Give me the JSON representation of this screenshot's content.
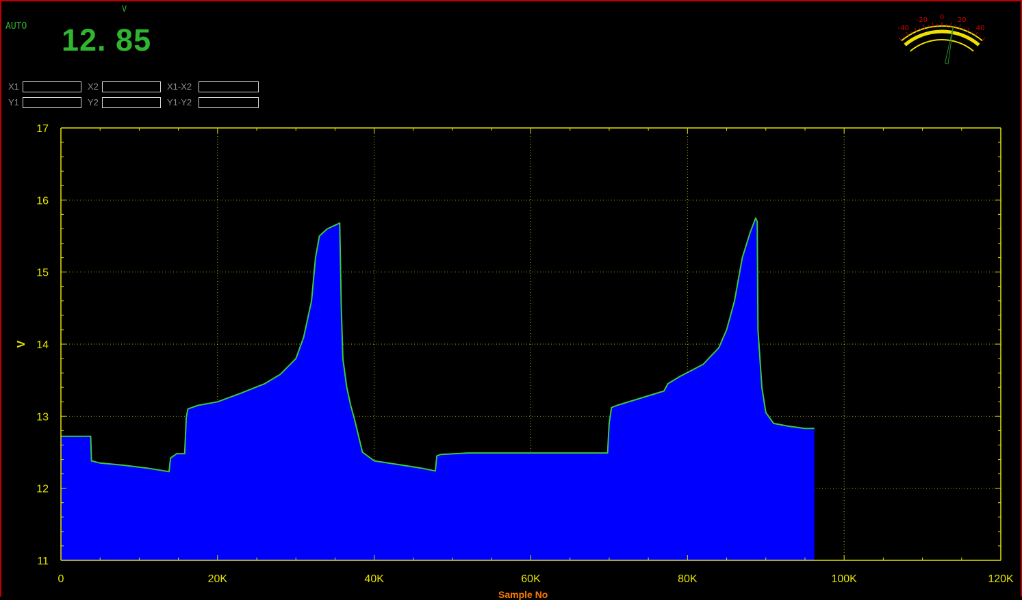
{
  "header": {
    "mode": "AUTO",
    "unit": "V",
    "reading": "12. 85"
  },
  "cursors": {
    "x1_label": "X1",
    "x1_value": "",
    "x2_label": "X2",
    "x2_value": "",
    "dx_label": "X1-X2",
    "dx_value": "",
    "y1_label": "Y1",
    "y1_value": "",
    "y2_label": "Y2",
    "y2_value": "",
    "dy_label": "Y1-Y2",
    "dy_value": ""
  },
  "gauge": {
    "ticks": [
      "-40",
      "-20",
      "0",
      "20",
      "40"
    ],
    "needle_value": 12.85
  },
  "colors": {
    "background": "#000000",
    "fill": "#0000ff",
    "trace": "#3cc83c",
    "axis": "#e5e500",
    "text_green": "#2fb52f",
    "gauge": "#f0e000",
    "gauge_ticks": "#d00000",
    "frame": "#c00000"
  },
  "chart_data": {
    "type": "area",
    "xlabel": "Sample No",
    "ylabel": "V",
    "xlim": [
      0,
      120000
    ],
    "ylim": [
      11,
      17
    ],
    "x_ticks": [
      "0",
      "20K",
      "40K",
      "60K",
      "80K",
      "100K",
      "120K"
    ],
    "y_ticks": [
      "11",
      "12",
      "13",
      "14",
      "15",
      "16",
      "17"
    ],
    "grid": true,
    "series": [
      {
        "x": [
          0,
          3800,
          3900,
          5000,
          8000,
          11000,
          13800,
          14000,
          14800,
          15800,
          16000,
          16200,
          17500,
          20000,
          23000,
          26000,
          28000,
          30000,
          31000,
          32000,
          32500,
          33000,
          34000,
          35000,
          35600,
          35800,
          36000,
          36500,
          37000,
          37500,
          38500,
          40000,
          43000,
          46000,
          47800,
          48000,
          48500,
          52000,
          56000,
          60000,
          64000,
          68000,
          69800,
          70000,
          70300,
          71000,
          74000,
          77000,
          77500,
          79000,
          82000,
          84000,
          85000,
          86000,
          87000,
          88000,
          88700,
          88900,
          89000,
          89500,
          90000,
          91000,
          93000,
          95000,
          96200
        ],
        "y": [
          12.72,
          12.72,
          12.38,
          12.35,
          12.32,
          12.28,
          12.23,
          12.42,
          12.48,
          12.48,
          12.98,
          13.1,
          13.15,
          13.2,
          13.32,
          13.45,
          13.58,
          13.8,
          14.1,
          14.6,
          15.2,
          15.5,
          15.6,
          15.65,
          15.68,
          14.5,
          13.8,
          13.4,
          13.15,
          12.95,
          12.5,
          12.38,
          12.33,
          12.28,
          12.24,
          12.45,
          12.47,
          12.49,
          12.49,
          12.49,
          12.49,
          12.49,
          12.49,
          12.9,
          13.12,
          13.15,
          13.25,
          13.35,
          13.45,
          13.55,
          13.72,
          13.95,
          14.2,
          14.6,
          15.2,
          15.55,
          15.75,
          15.7,
          14.2,
          13.4,
          13.05,
          12.9,
          12.86,
          12.83,
          12.83
        ]
      }
    ]
  }
}
